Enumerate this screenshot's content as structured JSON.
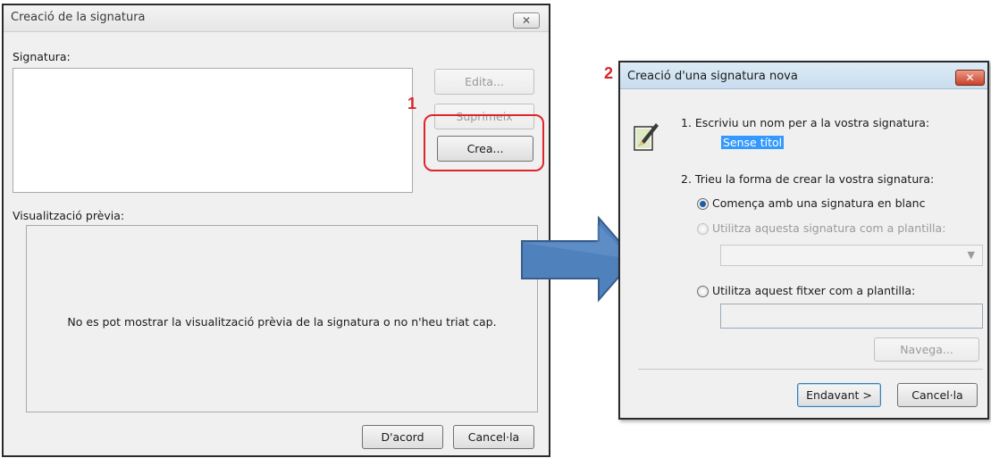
{
  "dialog1": {
    "title": "Creació de la signatura",
    "close_label": "X",
    "signature_label": "Signatura:",
    "edit_label": "Edita...",
    "delete_label": "Suprimeix",
    "create_label": "Crea...",
    "preview_label": "Visualització prèvia:",
    "preview_message": "No es pot mostrar la visualització prèvia de la signatura o no n'heu triat cap.",
    "ok_label": "D'acord",
    "cancel_label": "Cancel·la"
  },
  "annotations": {
    "step1_number": "1",
    "step2_number": "2",
    "highlight_color": "#e0252a",
    "arrow_color": "#4f81bd"
  },
  "dialog2": {
    "title": "Creació d'una signatura nova",
    "step1_text": "1. Escriviu un nom per a la vostra signatura:",
    "name_value": "Sense títol",
    "step2_text": "2. Trieu la forma de crear la vostra signatura:",
    "option_blank": "Comença amb una signatura en blanc",
    "option_signature_template": "Utilitza aquesta signatura com a plantilla:",
    "option_file_template": "Utilitza aquest fitxer com a plantilla:",
    "selected_option": "option_blank",
    "browse_label": "Navega...",
    "next_label": "Endavant >",
    "cancel_label": "Cancel·la"
  }
}
